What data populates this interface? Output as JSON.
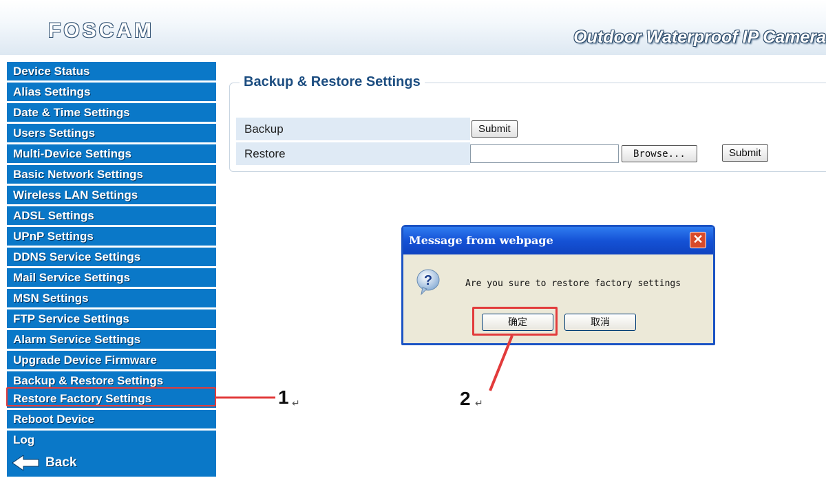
{
  "header": {
    "logo": "FOSCAM",
    "tagline": "Outdoor Waterproof IP Camera"
  },
  "sidebar": {
    "items": [
      {
        "label": "Device Status"
      },
      {
        "label": "Alias Settings"
      },
      {
        "label": "Date & Time Settings"
      },
      {
        "label": "Users Settings"
      },
      {
        "label": "Multi-Device Settings"
      },
      {
        "label": "Basic Network Settings"
      },
      {
        "label": "Wireless LAN Settings"
      },
      {
        "label": "ADSL Settings"
      },
      {
        "label": "UPnP Settings"
      },
      {
        "label": "DDNS Service Settings"
      },
      {
        "label": "Mail Service Settings"
      },
      {
        "label": "MSN Settings"
      },
      {
        "label": "FTP Service Settings"
      },
      {
        "label": "Alarm Service Settings"
      },
      {
        "label": "Upgrade Device Firmware"
      },
      {
        "label": "Backup & Restore Settings"
      },
      {
        "label": "Restore Factory Settings"
      },
      {
        "label": "Reboot Device"
      },
      {
        "label": "Log"
      }
    ],
    "back_label": "Back"
  },
  "panel": {
    "title": "Backup & Restore Settings",
    "backup_label": "Backup",
    "restore_label": "Restore",
    "submit_label": "Submit",
    "browse_label": "Browse..."
  },
  "dialog": {
    "title": "Message from webpage",
    "message": "Are you sure to restore factory settings",
    "ok_label": "确定",
    "cancel_label": "取消"
  },
  "annotations": {
    "step1": "1",
    "step2": "2",
    "return_mark": "↵"
  },
  "colors": {
    "sidebar_bg": "#0a78c8",
    "highlight": "#e23b3b",
    "dialog_title": "#1552d6"
  }
}
